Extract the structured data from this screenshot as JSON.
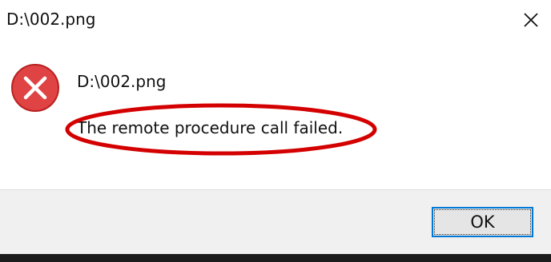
{
  "window": {
    "title": "D:\\002.png",
    "close_icon": "close-icon"
  },
  "message": {
    "icon": "error-icon",
    "icon_color": "#e81123",
    "heading": "D:\\002.png",
    "text": "The remote procedure call failed."
  },
  "annotation": {
    "color": "#d40000"
  },
  "buttons": {
    "ok_label": "OK"
  }
}
